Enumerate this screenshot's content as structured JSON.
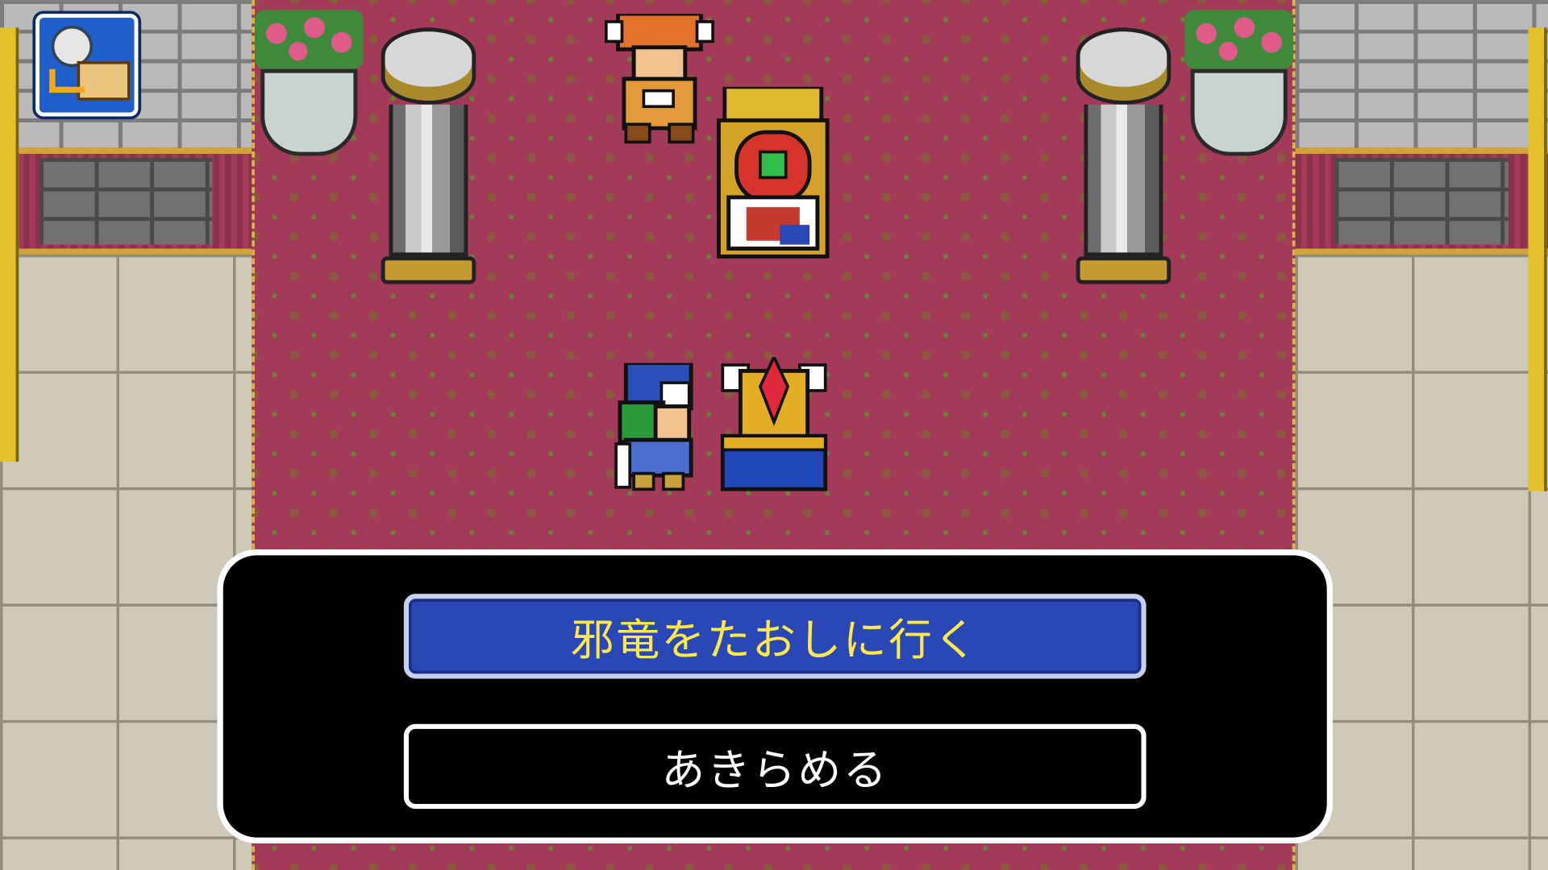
{
  "dialog": {
    "choices": [
      {
        "label": "邪竜をたおしに行く",
        "selected": true
      },
      {
        "label": "あきらめる",
        "selected": false
      }
    ]
  },
  "hud": {
    "menu_icon": "compass-map-icon"
  },
  "colors": {
    "carpet": "#a33a57",
    "selected_choice_bg": "#2a47b8",
    "selected_choice_text": "#ffe94a",
    "dialog_bg": "#000000",
    "dialog_border": "#ffffff"
  }
}
